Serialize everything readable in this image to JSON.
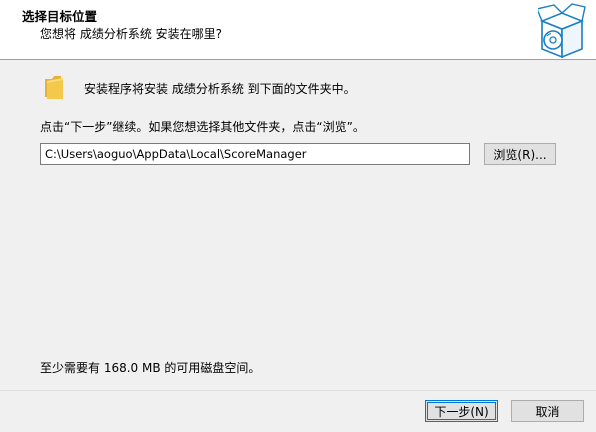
{
  "header": {
    "title": "选择目标位置",
    "subtitle": "您想将 成绩分析系统 安装在哪里?"
  },
  "body": {
    "intro": "安装程序将安装 成绩分析系统 到下面的文件夹中。",
    "instruction": "点击“下一步”继续。如果您想选择其他文件夹，点击“浏览”。",
    "install_path": "C:\\Users\\aoguo\\AppData\\Local\\ScoreManager",
    "browse_label": "浏览(R)...",
    "disk_space": "至少需要有 168.0 MB 的可用磁盘空间。"
  },
  "footer": {
    "next_label": "下一步(N)",
    "cancel_label": "取消"
  },
  "icons": {
    "header_image": "installer-box-icon",
    "folder": "folder-icon"
  },
  "colors": {
    "header_bg": "#ffffff",
    "dialog_bg": "#f0f0f0",
    "default_button_border": "#0078d7",
    "folder_yellow": "#f4c84a"
  }
}
